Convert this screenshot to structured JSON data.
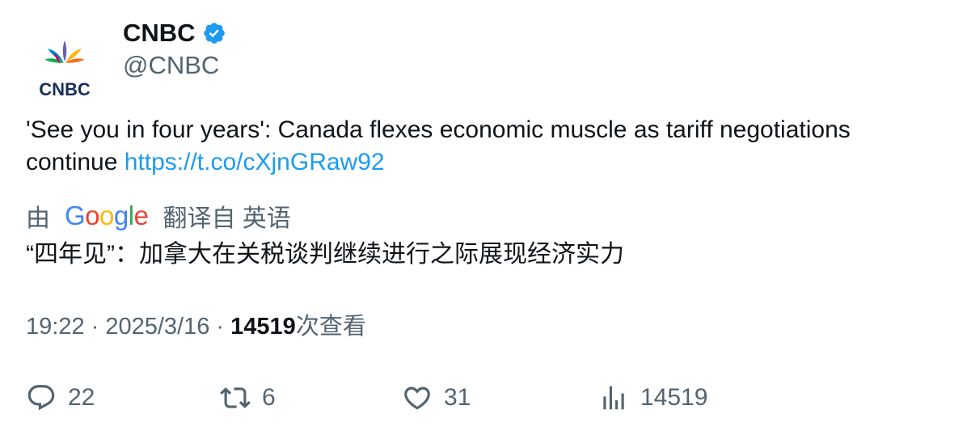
{
  "author": {
    "display_name": "CNBC",
    "handle": "@CNBC",
    "logo_text": "CNBC",
    "verified": true,
    "verified_color": "#1d9bf0"
  },
  "tweet": {
    "text_before_link": "'See you in four years': Canada flexes economic muscle as tariff negotiations continue ",
    "link": "https://t.co/cXjnGRaw92",
    "link_color": "#1d9bf0"
  },
  "translation": {
    "prefix": "由",
    "provider": "Google",
    "suffix": "翻译自 英语",
    "text": "“四年见”：加拿大在关税谈判继续进行之际展现经济实力"
  },
  "meta": {
    "time": "19:22",
    "separator": " · ",
    "date": "2025/3/16",
    "views_count": "14519",
    "views_label": "次查看"
  },
  "actions": {
    "replies": "22",
    "retweets": "6",
    "likes": "31",
    "views": "14519"
  },
  "icons": {
    "reply": "reply-icon",
    "retweet": "retweet-icon",
    "like": "heart-icon",
    "views": "views-chart-icon",
    "verified": "verified-badge-icon"
  }
}
